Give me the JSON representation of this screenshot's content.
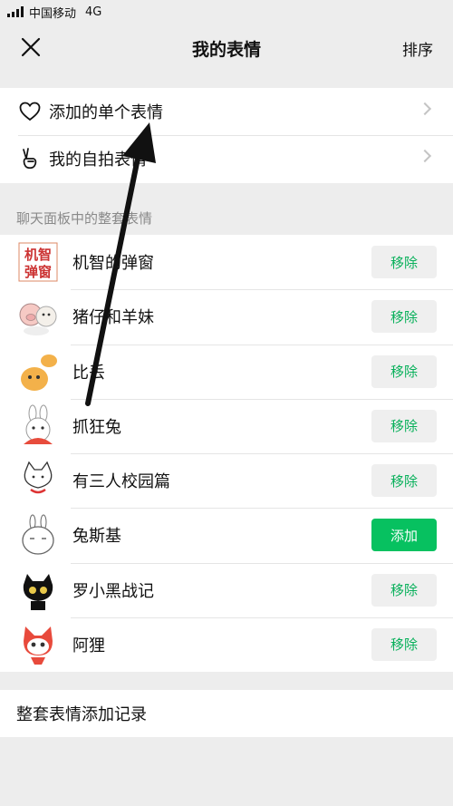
{
  "status_bar": {
    "carrier": "中国移动",
    "network": "4G"
  },
  "nav": {
    "title": "我的表情",
    "sort_label": "排序",
    "close_icon": "close-icon"
  },
  "top_group": [
    {
      "label": "添加的单个表情",
      "icon": "heart-outline-icon"
    },
    {
      "label": "我的自拍表情",
      "icon": "peace-hand-icon"
    }
  ],
  "section_label": "聊天面板中的整套表情",
  "packs": [
    {
      "name": "机智的弹窗",
      "action": "移除",
      "thumb_text": [
        "机智",
        "弹窗"
      ]
    },
    {
      "name": "猪仔和羊妹",
      "action": "移除"
    },
    {
      "name": "比丢",
      "action": "移除"
    },
    {
      "name": "抓狂兔",
      "action": "移除"
    },
    {
      "name": "有三人校园篇",
      "action": "移除"
    },
    {
      "name": "兔斯基",
      "action": "添加"
    },
    {
      "name": "罗小黑战记",
      "action": "移除"
    },
    {
      "name": "阿狸",
      "action": "移除"
    }
  ],
  "footer_row": {
    "label": "整套表情添加记录"
  },
  "colors": {
    "green": "#07c160",
    "remove_text": "#07b05a",
    "background": "#ededed"
  }
}
